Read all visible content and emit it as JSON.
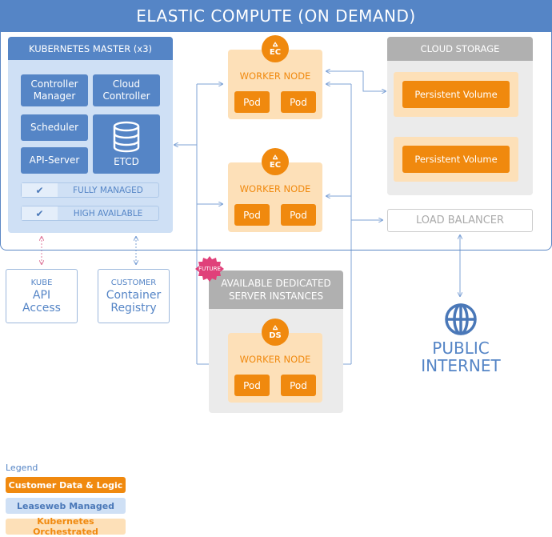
{
  "title": "ELASTIC COMPUTE (ON DEMAND)",
  "master": {
    "title": "KUBERNETES MASTER (x3)",
    "components": [
      {
        "l1": "Controller",
        "l2": "Manager"
      },
      {
        "l1": "Cloud",
        "l2": "Controller"
      },
      {
        "l1": "Scheduler"
      },
      {
        "l1": "API-Server"
      }
    ],
    "etcd": "ETCD",
    "features": [
      {
        "check": "✔",
        "label": "FULLY MANAGED"
      },
      {
        "check": "✔",
        "label": "HIGH AVAILABLE"
      }
    ]
  },
  "worker_nodes": [
    {
      "badge": "EC",
      "title": "WORKER NODE",
      "pods": [
        "Pod",
        "Pod"
      ]
    },
    {
      "badge": "EC",
      "title": "WORKER NODE",
      "pods": [
        "Pod",
        "Pod"
      ]
    },
    {
      "badge": "DS",
      "title": "WORKER NODE",
      "pods": [
        "Pod",
        "Pod"
      ]
    }
  ],
  "storage": {
    "title": "CLOUD STORAGE",
    "volumes": [
      "Persistent Volume",
      "Persistent Volume"
    ]
  },
  "load_balancer": "LOAD BALANCER",
  "kube_api": {
    "small": "KUBE",
    "l1": "API",
    "l2": "Access"
  },
  "registry": {
    "small": "CUSTOMER",
    "l1": "Container",
    "l2": "Registry"
  },
  "dedicated": {
    "l1": "AVAILABLE DEDICATED",
    "l2": "SERVER INSTANCES",
    "badge": "FUTURE"
  },
  "internet": {
    "l1": "PUBLIC",
    "l2": "INTERNET"
  },
  "legend": {
    "title": "Legend",
    "items": [
      {
        "label": "Customer Data & Logic",
        "bg": "#f0890e",
        "fg": "#ffffff"
      },
      {
        "label": "Leaseweb Managed",
        "bg": "#cfe0f5",
        "fg": "#4a78b8"
      },
      {
        "label": "Kubernetes Orchestrated",
        "bg": "#fde0b8",
        "fg": "#f0890e"
      }
    ]
  },
  "colors": {
    "blue": "#5585c6",
    "orange": "#f0890e",
    "light_orange": "#fde0b8",
    "light_blue": "#cfe0f5",
    "grey": "#b0b0b0",
    "pink": "#e0407a"
  }
}
